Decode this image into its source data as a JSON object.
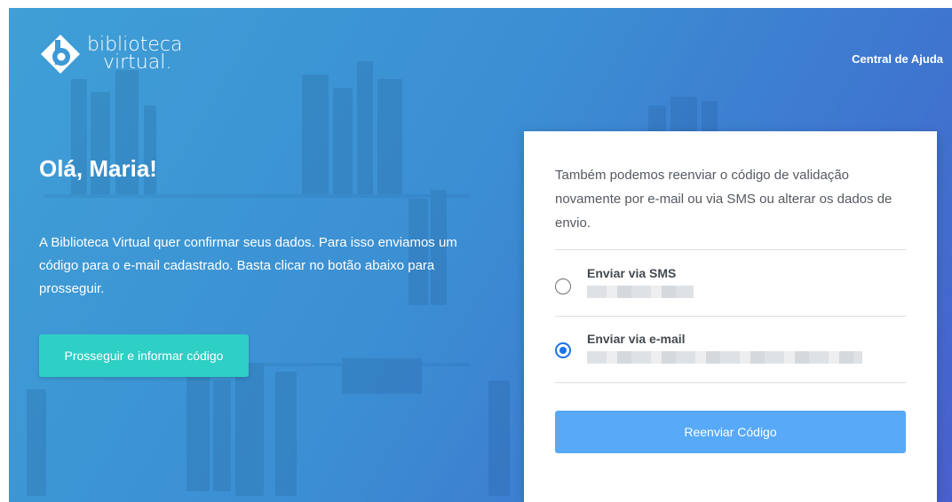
{
  "header": {
    "logo": {
      "line1": "biblioteca",
      "line2": "virtual."
    },
    "help_link": "Central de Ajuda"
  },
  "hero": {
    "greeting": "Olá, Maria!",
    "intro": "A Biblioteca Virtual quer confirmar seus dados. Para isso enviamos um código para o e-mail cadastrado. Basta clicar no botão abaixo para prosseguir.",
    "proceed_button": "Prosseguir e informar código"
  },
  "resend_card": {
    "description": "Também podemos reenviar o código de validação novamente por e-mail ou via SMS ou alterar os dados de envio.",
    "options": [
      {
        "label": "Enviar via SMS",
        "selected": false
      },
      {
        "label": "Enviar via e-mail",
        "selected": true
      }
    ],
    "resend_button": "Reenviar Código"
  },
  "colors": {
    "accent_teal": "#2ecfc4",
    "accent_blue": "#58a9f7",
    "radio_selected": "#1a73e8"
  },
  "icons": {
    "logo": "biblioteca-virtual-b-logo-icon"
  }
}
